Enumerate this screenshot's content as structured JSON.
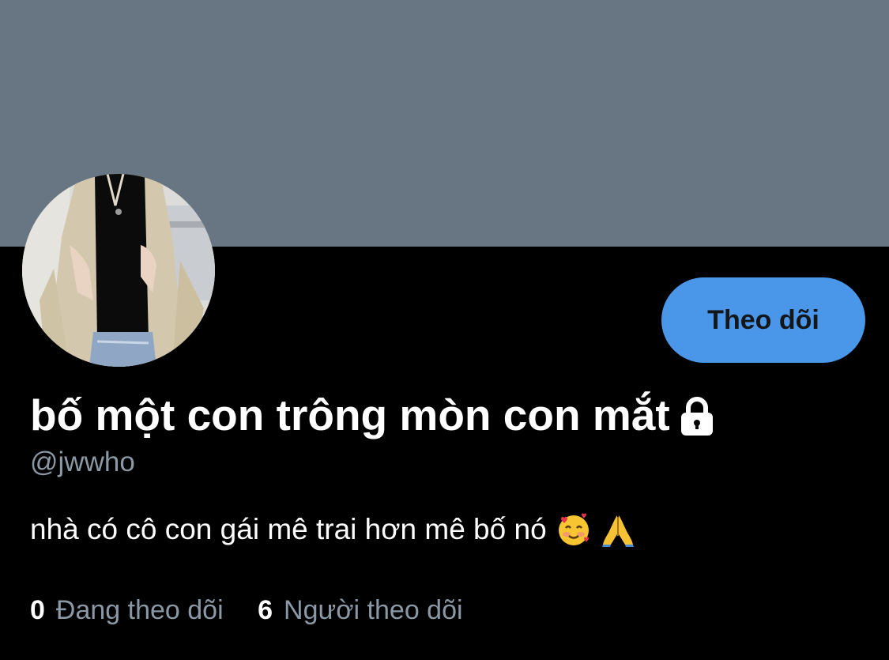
{
  "colors": {
    "banner": "#687684",
    "background": "#000000",
    "accent": "#4a97ea",
    "secondary_text": "#8b98a5",
    "primary_text": "#ffffff"
  },
  "profile": {
    "display_name": "bố một con trông mòn con mắt",
    "lock_icon": "lock-icon",
    "handle": "@jwwho",
    "bio": "nhà có cô con gái mê trai hơn mê bố nó",
    "bio_emojis": [
      "smiling-face-with-hearts-icon",
      "folded-hands-icon"
    ],
    "avatar_icon": "profile-avatar"
  },
  "actions": {
    "follow_label": "Theo dõi"
  },
  "stats": {
    "following_count": "0",
    "following_label": "Đang theo dõi",
    "followers_count": "6",
    "followers_label": "Người theo dõi"
  }
}
